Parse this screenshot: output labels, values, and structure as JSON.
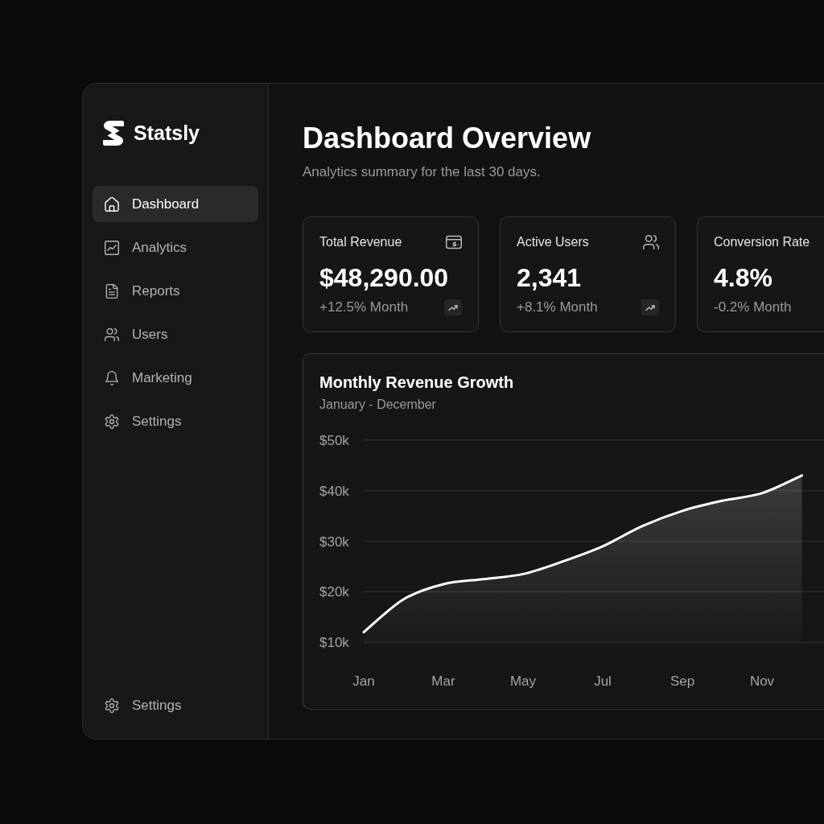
{
  "sidebar": {
    "brand": "Statsly",
    "items": [
      {
        "label": "Dashboard",
        "selected": true
      },
      {
        "label": "Analytics",
        "selected": false
      },
      {
        "label": "Reports",
        "selected": false
      },
      {
        "label": "Users",
        "selected": false
      },
      {
        "label": "Marketing",
        "selected": false
      },
      {
        "label": "Settings",
        "selected": false
      }
    ],
    "footer_item": {
      "label": "Settings"
    }
  },
  "header": {
    "title": "Dashboard Overview",
    "subtitle": "Analytics summary for the last 30 days."
  },
  "stats": [
    {
      "label": "Total Revenue",
      "value": "$48,290.00",
      "change": "+12.5% Month",
      "trend_icon": true
    },
    {
      "label": "Active Users",
      "value": "2,341",
      "change": "+8.1% Month",
      "trend_icon": true
    },
    {
      "label": "Conversion Rate",
      "value": "4.8%",
      "change": "-0.2% Month",
      "trend_icon": false
    }
  ],
  "revenue_chart": {
    "subtitle": "January - December",
    "chart_data": {
      "type": "area",
      "title": "Monthly Revenue Growth",
      "categories": [
        "Jan",
        null,
        "Mar",
        null,
        "May",
        null,
        "Jul",
        null,
        "Sep",
        null,
        "Nov",
        null
      ],
      "values": [
        12000,
        18500,
        21500,
        22500,
        23500,
        26000,
        29000,
        33000,
        36000,
        38000,
        39500,
        43000
      ],
      "yticks": [
        {
          "value": 50000,
          "label": "$50k"
        },
        {
          "value": 40000,
          "label": "$40k"
        },
        {
          "value": 30000,
          "label": "$30k"
        },
        {
          "value": 20000,
          "label": "$20k"
        },
        {
          "value": 10000,
          "label": "$10k"
        }
      ],
      "ylim": [
        10000,
        50000
      ],
      "grid": true
    }
  }
}
